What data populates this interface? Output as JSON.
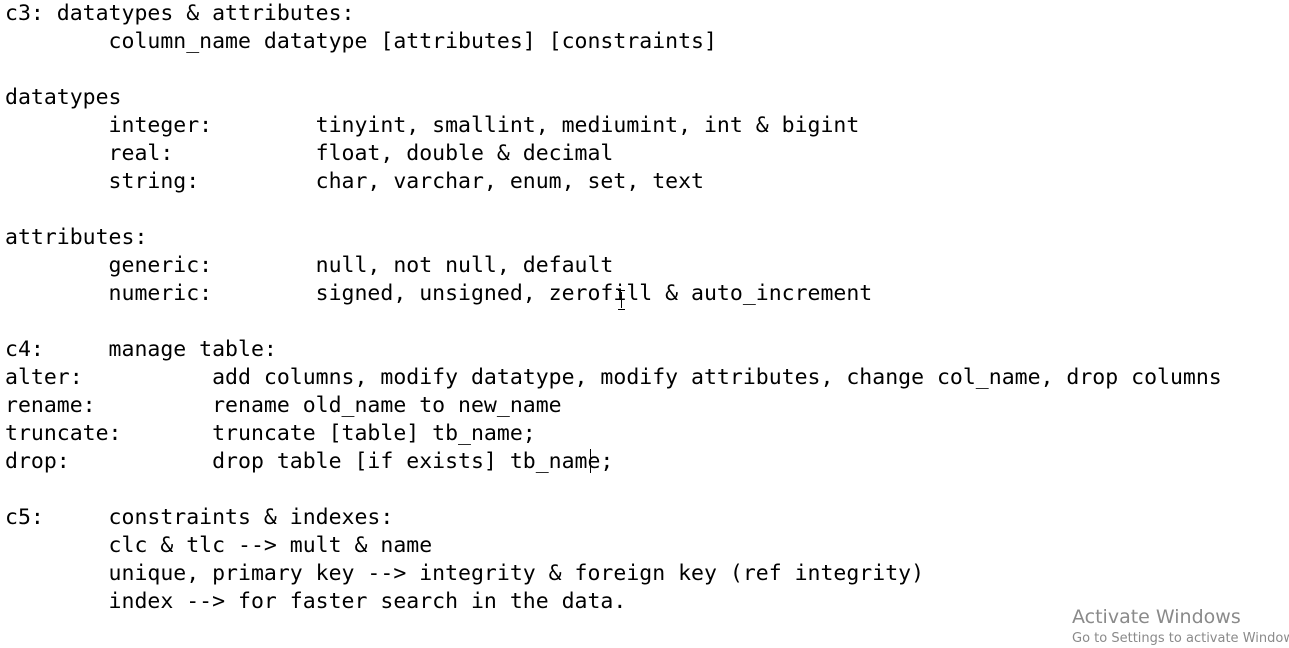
{
  "document": {
    "lines": [
      "c3: datatypes & attributes:",
      "        column_name datatype [attributes] [constraints]",
      "",
      "datatypes",
      "        integer:        tinyint, smallint, mediumint, int & bigint",
      "        real:           float, double & decimal",
      "        string:         char, varchar, enum, set, text",
      "",
      "attributes:",
      "        generic:        null, not null, default",
      "        numeric:        signed, unsigned, zerofill & auto_increment",
      "",
      "c4:     manage table:",
      "alter:          add columns, modify datatype, modify attributes, change col_name, drop columns",
      "rename:         rename old_name to new_name",
      "truncate:       truncate [table] tb_name;",
      "drop:           drop table [if exists] tb_name;",
      "",
      "c5:     constraints & indexes:",
      "        clc & tlc --> mult & name",
      "        unique, primary key --> integrity & foreign key (ref integrity)",
      "        index --> for faster search in the data."
    ]
  },
  "watermark": {
    "title": "Activate Windows",
    "subtitle": "Go to Settings to activate Windows."
  },
  "colors": {
    "background": "#ffffff",
    "text": "#000000",
    "watermark": "#8a8a8a"
  },
  "icons": {
    "text_cursor": "i-beam-cursor-icon"
  }
}
